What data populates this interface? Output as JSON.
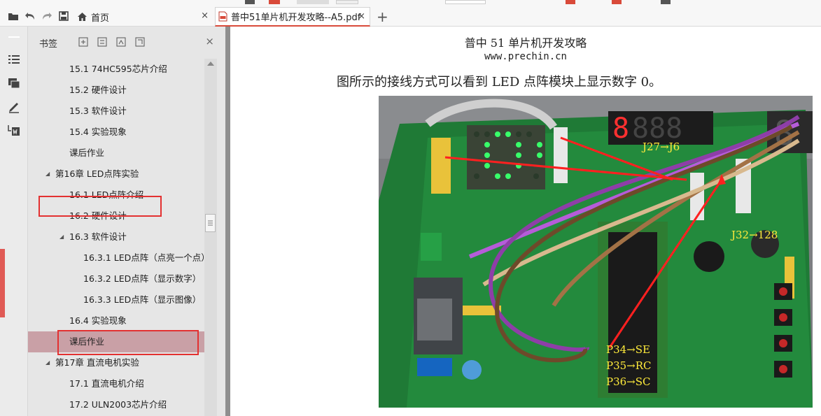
{
  "tabs": {
    "home_label": "首页",
    "pdf_label": "普中51单片机开发攻略--A5.pdf",
    "close_symbol": "×",
    "new_tab_symbol": "+"
  },
  "bookmarks": {
    "title": "书签",
    "close_symbol": "×",
    "items": [
      {
        "label": "15.1 74HC595芯片介绍"
      },
      {
        "label": "15.2 硬件设计"
      },
      {
        "label": "15.3 软件设计"
      },
      {
        "label": "15.4 实验现象"
      },
      {
        "label": "课后作业"
      },
      {
        "label": "第16章 LED点阵实验"
      },
      {
        "label": "16.1 LED点阵介绍"
      },
      {
        "label": "16.2 硬件设计"
      },
      {
        "label": "16.3 软件设计"
      },
      {
        "label": "16.3.1 LED点阵（点亮一个点）"
      },
      {
        "label": "16.3.2 LED点阵（显示数字）"
      },
      {
        "label": "16.3.3 LED点阵（显示图像）"
      },
      {
        "label": "16.4 实验现象"
      },
      {
        "label": "课后作业"
      },
      {
        "label": "第17章 直流电机实验"
      },
      {
        "label": "17.1 直流电机介绍"
      },
      {
        "label": "17.2 ULN2003芯片介绍"
      }
    ]
  },
  "document": {
    "header_title": "普中 51 单片机开发攻略",
    "header_url": "www.prechin.cn",
    "paragraph": "图所示的接线方式可以看到 LED 点阵模块上显示数字 0。",
    "photo_labels": {
      "j27": "J27→J6",
      "j32": "J32→128",
      "p34": "P34→SE",
      "p35": "P35→RC",
      "p36": "P36→SC"
    }
  },
  "colors": {
    "accent_red": "#e33131",
    "selected_bookmark": "#c9a0a6",
    "pcb_green": "#1f8a3c",
    "label_yellow": "#ffeb3b"
  }
}
